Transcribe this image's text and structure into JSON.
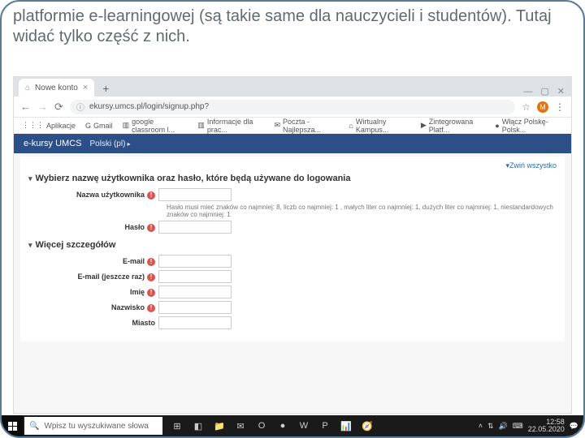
{
  "slide": {
    "caption": "platformie e-learningowej (są takie same dla nauczycieli i studentów). Tutaj widać tylko część z nich."
  },
  "browser": {
    "tab_title": "Nowe konto",
    "url": "ekursy.umcs.pl/login/signup.php?",
    "avatar_initial": "M",
    "window_controls": {
      "min": "—",
      "max": "▢",
      "close": "✕"
    },
    "bookmarks": [
      {
        "icon": "⋮⋮⋮",
        "label": "Aplikacje"
      },
      {
        "icon": "G",
        "label": "Gmail"
      },
      {
        "icon": "▥",
        "label": "google classroom l..."
      },
      {
        "icon": "▥",
        "label": "Informacje dla prac..."
      },
      {
        "icon": "✉",
        "label": "Poczta - Najlepsza..."
      },
      {
        "icon": "⌂",
        "label": "Wirtualny Kampus..."
      },
      {
        "icon": "▶",
        "label": "Zintegrowana Platf..."
      },
      {
        "icon": "●",
        "label": "Włącz Polskę- Polsk..."
      }
    ]
  },
  "page": {
    "brand": "e-kursy UMCS",
    "lang": "Polski (pl)",
    "collapse_all": "Zwiń wszystko",
    "section1_title": "Wybierz nazwę użytkownika oraz hasło, które będą używane do logowania",
    "section2_title": "Więcej szczegółów",
    "labels": {
      "username": "Nazwa użytkownika",
      "password": "Hasło",
      "email": "E-mail",
      "email2": "E-mail (jeszcze raz)",
      "firstname": "Imię",
      "lastname": "Nazwisko",
      "city": "Miasto"
    },
    "password_note": "Hasło musi mieć znaków co najmniej: 8, liczb co najmniej: 1 , małych liter co najmniej: 1, dużych liter co najmniej: 1, niestandardowych znaków co najmniej: 1"
  },
  "taskbar": {
    "search_placeholder": "Wpisz tu wyszukiwane słowa",
    "time": "12:58",
    "date": "22.05.2020",
    "apps": [
      "⊞",
      "◧",
      "📁",
      "✉",
      "O",
      "●",
      "W",
      "P",
      "📊",
      "🧭"
    ]
  }
}
